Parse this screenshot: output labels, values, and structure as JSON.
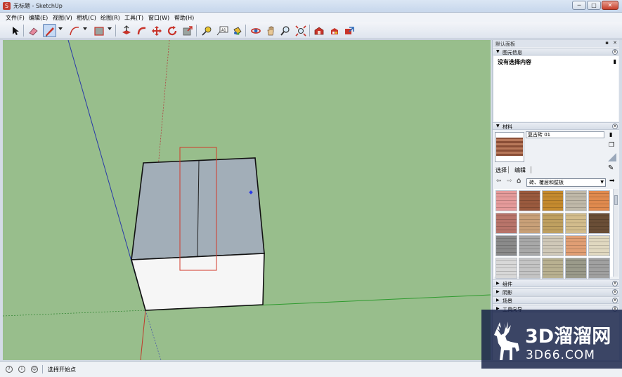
{
  "window": {
    "title": "无标题 - SketchUp",
    "min": "─",
    "max": "□",
    "close": "✕"
  },
  "menu": [
    {
      "label": "文件(F)"
    },
    {
      "label": "编辑(E)"
    },
    {
      "label": "视图(V)"
    },
    {
      "label": "相机(C)"
    },
    {
      "label": "绘图(R)"
    },
    {
      "label": "工具(T)"
    },
    {
      "label": "窗口(W)"
    },
    {
      "label": "帮助(H)"
    }
  ],
  "toolbar_icons": [
    "select-icon",
    "eraser-icon",
    "pencil-line-icon",
    "arc-icon",
    "rectangle-icon",
    "push-pull-icon",
    "follow-me-icon",
    "move-icon",
    "rotate-icon",
    "scale-icon",
    "tape-measure-icon",
    "text-icon",
    "paint-bucket-icon",
    "orbit-icon",
    "pan-icon",
    "zoom-icon",
    "zoom-extents-icon",
    "warehouse-icon",
    "components-icon",
    "share-icon"
  ],
  "panel": {
    "title": "默认面板",
    "entity_info": {
      "header": "图元信息",
      "empty": "没有选择内容"
    },
    "materials": {
      "header": "材料",
      "name_value": "复古砖 01",
      "tab_select": "选择",
      "tab_edit": "编辑",
      "library": "砖、覆层和壁板",
      "swatch_colors": [
        "#e49a9a",
        "#9a5a3e",
        "#c48a2e",
        "#bfb8a8",
        "#e08a4e",
        "#b8746a",
        "#c8a078",
        "#bfa060",
        "#d2bc8c",
        "#6a4e36",
        "#8a8a8a",
        "#a8a8a8",
        "#cfc8b8",
        "#e09e74",
        "#e0d8c0",
        "#d8d8d8",
        "#c4c4c4",
        "#b8b090",
        "#9a9a8a",
        "#a0a0a0"
      ]
    },
    "collapsed": [
      {
        "label": "组件"
      },
      {
        "label": "阴影"
      },
      {
        "label": "场景"
      },
      {
        "label": "工具向导"
      }
    ]
  },
  "status": {
    "text": "选择开始点"
  },
  "watermark": {
    "big": "3D溜溜网",
    "small": "3D66.COM"
  }
}
